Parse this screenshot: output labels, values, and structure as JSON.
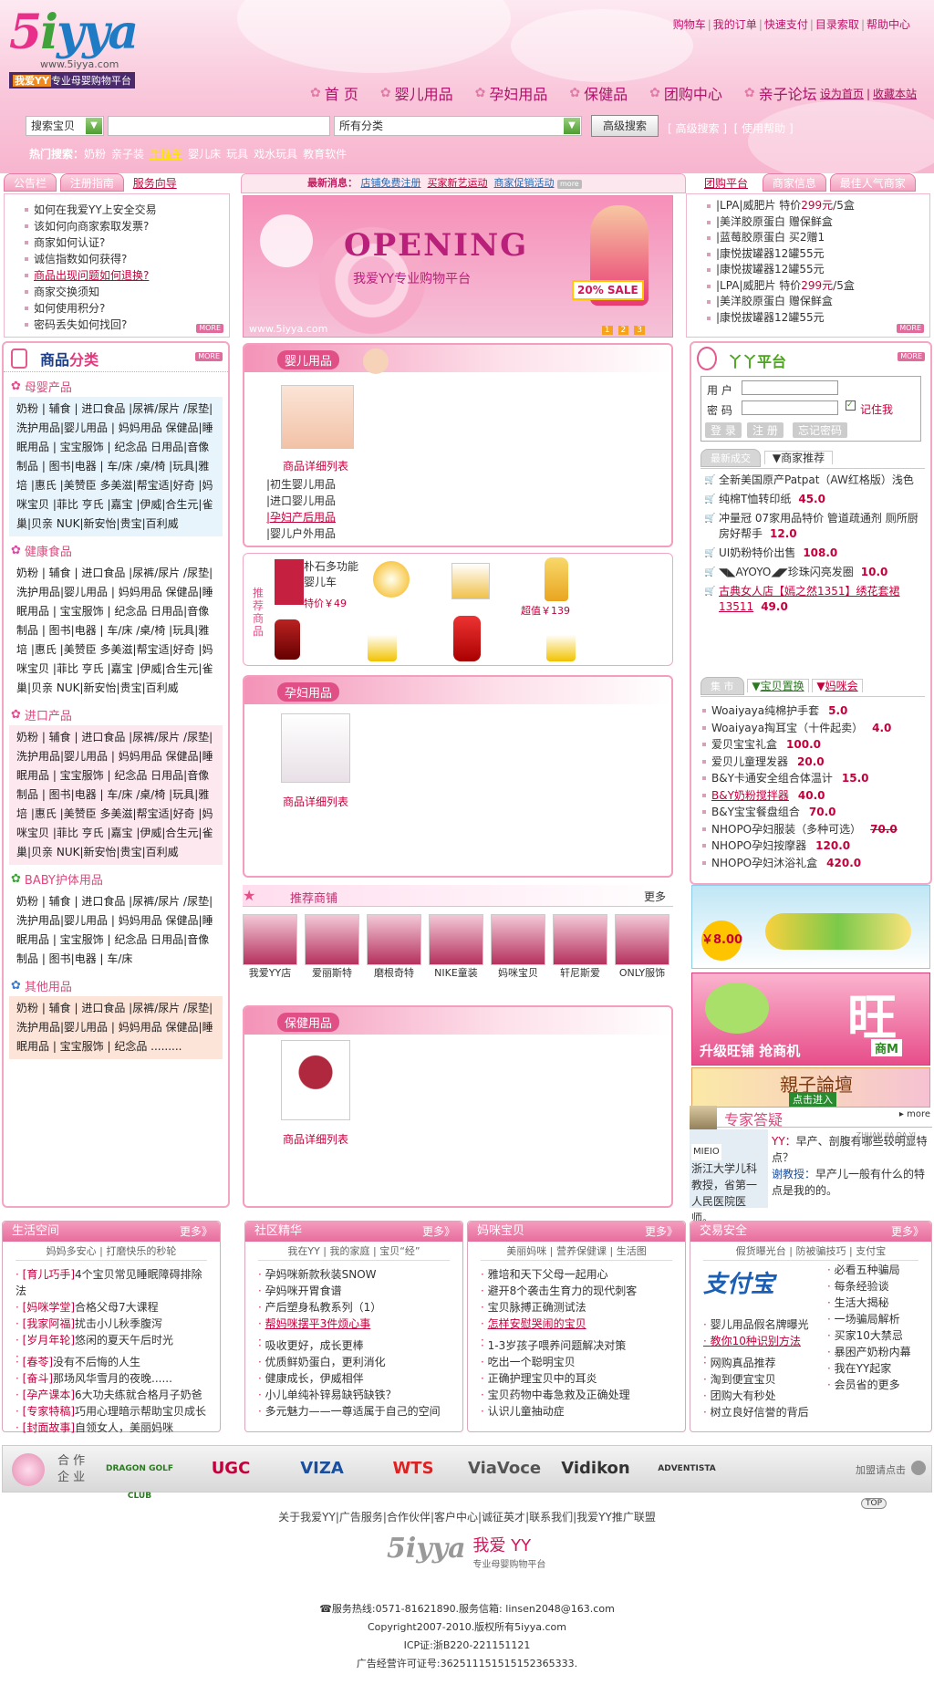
{
  "header": {
    "logo": {
      "mark": "5iyya",
      "url": "www.5iyya.com",
      "tag_badge": "我爱YY",
      "tag": "专业母婴购物平台"
    },
    "top_links": [
      "购物车",
      "我的订单",
      "快速支付",
      "目录索取",
      "帮助中心"
    ],
    "nav": [
      {
        "label": "首 页",
        "icon": "home-icon"
      },
      {
        "label": "婴儿用品",
        "icon": "baby-icon"
      },
      {
        "label": "孕妇用品",
        "icon": "maternity-icon"
      },
      {
        "label": "保健品",
        "icon": "health-icon"
      },
      {
        "label": "团购中心",
        "icon": "group-buy-icon"
      },
      {
        "label": "亲子论坛",
        "icon": "forum-icon"
      }
    ],
    "home_links": [
      "设为首页",
      "收藏本站"
    ]
  },
  "search": {
    "type_value": "搜索宝贝",
    "keyword_value": "",
    "category_value": "所有分类",
    "button": "高级搜索",
    "links": [
      "高级搜索",
      "使用帮助"
    ],
    "hot_label": "热门搜索：",
    "hot": [
      "奶粉",
      "亲子装",
      "手推车",
      "婴儿床",
      "玩具",
      "戏水玩具",
      "教育软件"
    ],
    "hot_highlight": "手推车"
  },
  "bar": {
    "tabs_left": [
      "公告栏",
      "注册指南",
      "服务向导"
    ],
    "news_label": "最新消息：",
    "news": [
      "店铺免费注册",
      "买家新艺运动",
      "商家促销活动"
    ],
    "news_more": "more",
    "tabs_right": [
      "团购平台",
      "商家信息",
      "最佳人气商家"
    ]
  },
  "notice": {
    "items": [
      "如何在我爱YY上安全交易",
      "该如何向商家索取发票?",
      "商家如何认证?",
      "诚信指数如何获得?",
      "商品出现问题如何退换?",
      "商家交换须知",
      "如何使用积分?",
      "密码丢失如何找回?"
    ],
    "highlight_index": 4,
    "more": "MORE"
  },
  "banner": {
    "headline": "OPENING",
    "sub": "我爱YY专业购物平台",
    "sale": "20% SALE",
    "url": "www.5iyya.com",
    "pages": [
      "1",
      "2",
      "3"
    ]
  },
  "groupbuy": {
    "items": [
      {
        "text": "|LPA|威肥片 特价",
        "price": "299元",
        "suffix": "/5盒"
      },
      {
        "text": "|美洋胶原蛋白 赠保鲜盒",
        "price": "",
        "suffix": ""
      },
      {
        "text": "|蓝莓胶原蛋白 买2赠1",
        "price": "",
        "suffix": ""
      },
      {
        "text": "|康悦拔罐器12罐55元",
        "price": "",
        "suffix": ""
      },
      {
        "text": "|康悦拔罐器12罐55元",
        "price": "",
        "suffix": ""
      },
      {
        "text": "|LPA|威肥片 特价",
        "price": "299元",
        "suffix": "/5盒"
      },
      {
        "text": "|美洋胶原蛋白 赠保鲜盒",
        "price": "",
        "suffix": ""
      },
      {
        "text": "|康悦拔罐器12罐55元",
        "price": "",
        "suffix": ""
      }
    ],
    "more": "MORE"
  },
  "categories": {
    "title_a": "商品",
    "title_b": "分类",
    "more": "MORE",
    "groups": [
      {
        "name": "母婴产品",
        "text": "奶粉 | 辅食 | 进口食品 |尿裤/尿片 /尿垫|洗护用品|婴儿用品 | 妈妈用品 保健品|睡眠用品 | 宝宝服饰 | 纪念品 日用品|音像制品 | 图书|电器 | 车/床 /桌/椅 |玩具|雅培 |惠氏 |美赞臣 多美滋|帮宝适|好奇 |妈咪宝贝 |菲比 亨氏 |嘉宝 |伊威|合生元|雀巢|贝亲 NUK|新安怡|贵宝|百利威"
      },
      {
        "name": "健康食品",
        "text": "奶粉 | 辅食 | 进口食品 |尿裤/尿片 /尿垫|洗护用品|婴儿用品 | 妈妈用品 保健品|睡眠用品 | 宝宝服饰 | 纪念品 日用品|音像制品 | 图书|电器 | 车/床 /桌/椅 |玩具|雅培 |惠氏 |美赞臣 多美滋|帮宝适|好奇 |妈咪宝贝 |菲比 亨氏 |嘉宝 |伊威|合生元|雀巢|贝亲 NUK|新安怡|贵宝|百利威"
      },
      {
        "name": "进口产品",
        "text": "奶粉 | 辅食 | 进口食品 |尿裤/尿片 /尿垫|洗护用品|婴儿用品 | 妈妈用品 保健品|睡眠用品 | 宝宝服饰 | 纪念品 日用品|音像制品 | 图书|电器 | 车/床 /桌/椅 |玩具|雅培 |惠氏 |美赞臣 多美滋|帮宝适|好奇 |妈咪宝贝 |菲比 亨氏 |嘉宝 |伊威|合生元|雀巢|贝亲 NUK|新安怡|贵宝|百利威"
      },
      {
        "name": "BABY护体用品",
        "text": "奶粉 | 辅食 | 进口食品 |尿裤/尿片 /尿垫|洗护用品|婴儿用品 | 妈妈用品 保健品|睡眠用品 | 宝宝服饰 | 纪念品 日用品|音像制品 | 图书|电器 | 车/床"
      },
      {
        "name": "其他用品",
        "text": "奶粉 | 辅食 | 进口食品 |尿裤/尿片 /尿垫|洗护用品|婴儿用品 | 妈妈用品 保健品|睡眠用品 | 宝宝服饰 | 纪念品 ........."
      }
    ]
  },
  "baby_section": {
    "title": "婴儿用品",
    "detail": "商品详细列表",
    "links": [
      "|初生婴儿用品",
      "|进口婴儿用品",
      "|孕妇产后用品",
      "|婴儿户外用品"
    ]
  },
  "recommend": {
    "label": "推荐商品",
    "stroller_name": "朴石多功能婴儿车",
    "stroller_price": "特价￥49",
    "bottle_price": "超值￥139"
  },
  "maternity_section": {
    "title": "孕妇用品",
    "detail": "商品详细列表"
  },
  "shops": {
    "title": "推荐商铺",
    "more": "更多",
    "items": [
      "我爱YY店",
      "爱丽斯特",
      "磨根奇特",
      "NIKE童装",
      "妈咪宝贝",
      "轩尼斯爱",
      "ONLY服饰"
    ]
  },
  "health_section": {
    "title": "保健用品",
    "detail": "商品详细列表"
  },
  "yy_platform": {
    "title": "丫丫平台",
    "more": "MORE",
    "user_label": "用 户",
    "pwd_label": "密 码",
    "user_value": "",
    "pwd_value": "",
    "remember": "记住我",
    "buttons": [
      "登 录",
      "注 册",
      "忘记密码"
    ]
  },
  "recommend_tabs": [
    "最新成交",
    "商家推荐"
  ],
  "recommend_list": [
    {
      "text": "全新美国原产Patpat（AW红格版）浅色",
      "price": ""
    },
    {
      "text": "纯棉T恤转印纸",
      "price": "45.0"
    },
    {
      "text": "冲量冠 07家用品特价 管道疏通剂 厕所厨房好帮手",
      "price": "12.0"
    },
    {
      "text": "UI奶粉特价出售",
      "price": "108.0"
    },
    {
      "text": "◥◣AYOYO◢◤珍珠闪亮发圈",
      "price": "10.0"
    },
    {
      "text": "古典女人店【嫣之然1351】绣花套裙13511",
      "price": "49.0"
    }
  ],
  "market_tabs": [
    "集 市",
    "宝贝置换",
    "妈咪会"
  ],
  "market_list": [
    {
      "text": "Woaiyaya纯棉护手套",
      "price": "5.0",
      "old": ""
    },
    {
      "text": "Woaiyaya掏耳宝（十件起卖）",
      "price": "4.0",
      "old": ""
    },
    {
      "text": "爱贝宝宝礼盒",
      "price": "100.0",
      "old": ""
    },
    {
      "text": "爱贝儿童理发器",
      "price": "20.0",
      "old": ""
    },
    {
      "text": "B&Y卡通安全组合体温计",
      "price": "15.0",
      "old": ""
    },
    {
      "text": "B&Y奶粉搅拌器",
      "price": "40.0",
      "old": ""
    },
    {
      "text": "B&Y宝宝餐盘组合",
      "price": "70.0",
      "old": ""
    },
    {
      "text": "NHOPO孕妇服装（多种可选）",
      "price": "",
      "old": "70.0"
    },
    {
      "text": "NHOPO孕妇按摩器",
      "price": "120.0",
      "old": ""
    },
    {
      "text": "NHOPO孕妇沐浴礼盒",
      "price": "420.0",
      "old": ""
    }
  ],
  "ads": {
    "price_tag": "￥8.00",
    "wang": "旺",
    "wang_sub": "升级旺铺 抢商机",
    "wang_badge": "商M",
    "forum": "親子論壇",
    "forum_sub": "点击进入"
  },
  "expert": {
    "title": "专家答疑",
    "pinyin": "ZHUAN JIA DA YI",
    "more": "more",
    "name": "MIEIO",
    "bio": "浙江大学儿科教授，省第一人民医院医师。",
    "q_label": "YY：",
    "q": "早产、剖腹有哪些较明显特点？",
    "a_label": "谢教授：",
    "a": "早产儿一般有什么的特点是我的的。"
  },
  "bottom": [
    {
      "title": "生活空间",
      "more": "更多》",
      "sub": "妈妈多安心 | 打磨快乐的秒轮",
      "groups": [
        [
          {
            "tag": "[育儿巧手]",
            "text": "4个宝贝常见睡眠障碍排除法"
          },
          {
            "tag": "[妈咪学堂]",
            "text": "合格父母7大课程"
          },
          {
            "tag": "[我家阿福]",
            "text": "扰击小儿秋季腹泻"
          },
          {
            "tag": "[岁月年轮]",
            "text": "悠闲的夏天午后时光"
          }
        ],
        [
          {
            "tag": "[春苓]",
            "text": "没有不后悔的人生"
          },
          {
            "tag": "[奋斗]",
            "text": "那场风华雪月的夜晚......"
          },
          {
            "tag": "[孕产课本]",
            "text": "6大功夫练就合格月子奶爸"
          },
          {
            "tag": "[专家特稿]",
            "text": "巧用心理暗示帮助宝贝成长"
          },
          {
            "tag": "[封面故事]",
            "text": "自领女人，美丽妈咪"
          }
        ]
      ]
    },
    {
      "title": "社区精华",
      "more": "更多》",
      "sub": "我在YY | 我的家庭 | 宝贝“经”",
      "groups": [
        [
          {
            "tag": "",
            "text": "孕妈咪新款秋装SNOW"
          },
          {
            "tag": "",
            "text": "孕妈咪开胃食谱"
          },
          {
            "tag": "",
            "text": "产后塑身私教系列（1）"
          },
          {
            "tag": "",
            "text": "帮妈咪摆平3件烦心事"
          }
        ],
        [
          {
            "tag": "",
            "text": "吸收更好，成长更棒"
          },
          {
            "tag": "",
            "text": "优质鲜奶蛋白，更利消化"
          },
          {
            "tag": "",
            "text": "健康成长，伊威相伴"
          },
          {
            "tag": "",
            "text": "小儿单纯补锌易缺钙缺铁？"
          },
          {
            "tag": "",
            "text": "多元魅力——一尊适属于自己的空间"
          }
        ]
      ]
    },
    {
      "title": "妈咪宝贝",
      "more": "更多》",
      "sub": "美丽妈咪 | 营养保健课 | 生活图",
      "groups": [
        [
          {
            "tag": "",
            "text": "雅培和天下父母一起用心"
          },
          {
            "tag": "",
            "text": "避开8个袭击生育力的现代刺客"
          },
          {
            "tag": "",
            "text": "宝贝脉搏正确测试法"
          },
          {
            "tag": "",
            "text": "怎样安慰哭闹的宝贝"
          }
        ],
        [
          {
            "tag": "",
            "text": "1-3岁孩子喂养问题解决对策"
          },
          {
            "tag": "",
            "text": "吃出一个聪明宝贝"
          },
          {
            "tag": "",
            "text": "正确护理宝贝中的耳炎"
          },
          {
            "tag": "",
            "text": "宝贝药物中毒急救及正确处理"
          },
          {
            "tag": "",
            "text": "认识儿童抽动症"
          }
        ]
      ]
    },
    {
      "title": "交易安全",
      "more": "更多》",
      "sub": "假货曝光台 | 防被骗技巧 | 支付宝",
      "alipay": "支付宝",
      "right_col": [
        "必看五种骗局",
        "每条经验谈",
        "生活大揭秘"
      ],
      "groups": [
        [
          {
            "tag": "",
            "text": "婴儿用品假名牌曝光"
          },
          {
            "tag": "",
            "text": "教你10种识别方法"
          }
        ],
        [
          {
            "tag": "",
            "text": "网购真品推荐"
          },
          {
            "tag": "",
            "text": "淘到便宜宝贝"
          },
          {
            "tag": "",
            "text": "团购大有秒处"
          },
          {
            "tag": "",
            "text": "树立良好信誉的背后"
          }
        ]
      ],
      "right_col2": [
        "一场骗局解析",
        "买家10大禁忌",
        "暴困产奶粉内幕",
        "我在YY起家",
        "会员省的更多"
      ]
    }
  ],
  "partners": {
    "label_a": "合 作",
    "label_b": "企 业",
    "brands": [
      "DRAGON GOLF CLUB",
      "UGC",
      "VIZA",
      "WTS",
      "ViaVoce",
      "Vidikon",
      "ADVENTISTA"
    ],
    "join": "加盟请点击"
  },
  "footer": {
    "top": "TOP",
    "links": [
      "关于我爱YY",
      "广告服务",
      "合作伙伴",
      "客户中心",
      "诚征英才",
      "联系我们",
      "我爱YY推广联盟"
    ],
    "logo_mark": "5iyya",
    "logo_cn": "我爱 YY",
    "logo_sub": "专业母婴购物平台",
    "hotline": "☎服务热线:0571-81621890.服务信箱: linsen2048@163.com",
    "copyright": "Copyright2007-2010.版权所有5iyya.com",
    "icp": "ICP证:浙B220-221151121",
    "ad_license": "广告经营许可证号:362511151515152365333."
  }
}
